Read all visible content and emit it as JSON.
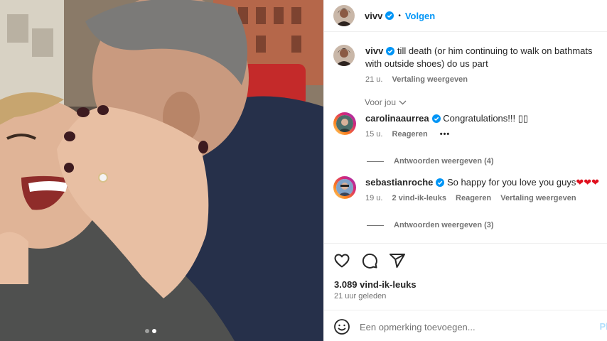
{
  "post": {
    "username": "vivv",
    "verified": true,
    "separator": "•",
    "follow_label": "Volgen",
    "caption": {
      "username": "vivv",
      "text": "till death (or him continuing to walk on bathmats with outside shoes) do us part",
      "time": "21 u.",
      "translate_label": "Vertaling weergeven"
    },
    "sort_label": "Voor jou",
    "comments": [
      {
        "username": "carolinaaurrea",
        "text": "Congratulations!!! ▯▯",
        "time": "15 u.",
        "reply_label": "Reageren",
        "more_label": "•••",
        "replies_label": "Antwoorden weergeven (4)"
      },
      {
        "username": "sebastianroche",
        "text": "So happy for you love you guys",
        "hearts": "❤❤❤",
        "time": "19 u.",
        "likes_label": "2 vind-ik-leuks",
        "reply_label": "Reageren",
        "translate_label": "Vertaling weergeven",
        "replies_label": "Antwoorden weergeven (3)"
      }
    ],
    "likes": "3.089 vind-ik-leuks",
    "posted_time": "21 uur geleden",
    "add_comment_placeholder": "Een opmerking toevoegen...",
    "post_label": "Pla"
  },
  "carousel": {
    "count": 2,
    "active": 2
  },
  "icons": {
    "like": "heart-icon",
    "comment": "comment-icon",
    "share": "share-icon",
    "emoji": "emoji-icon",
    "verified": "verified-badge-icon",
    "chevron": "chevron-down-icon"
  },
  "colors": {
    "accent": "#0095f6",
    "verified": "#0095f6",
    "muted": "#737373",
    "heart": "#e0101e"
  }
}
